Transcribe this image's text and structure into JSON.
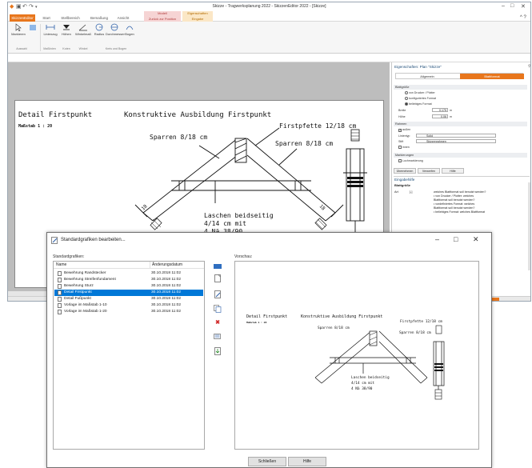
{
  "app": {
    "title": "Skizze - Tragwerksplanung 2022 - SkizzenEditor 2022 - [Skizze]",
    "window_controls": [
      "–",
      "□",
      "✕"
    ],
    "help_glyph": "^ ?",
    "tabs": [
      "SkizzenEditor",
      "Start",
      "Stellbereich",
      "Bemaßung",
      "Ansicht"
    ],
    "active_tab": "SkizzenEditor",
    "context_groups": [
      {
        "header": "Modell",
        "tab": "Zurück zur Position",
        "color": "#f6d4d4"
      },
      {
        "header": "Eigenschaften",
        "tab": "Eingabe",
        "color": "#fbe7c6"
      }
    ],
    "ribbon": {
      "buttons": [
        "Markieren",
        "Linienzug",
        "Höhen",
        "Winkelmaß",
        "Radius",
        "Durchmesser",
        "Bogen"
      ],
      "groups": [
        "Auswahl",
        "Maßlinien",
        "Koten",
        "Winkel",
        "Kreis und Bogen"
      ]
    }
  },
  "drawing": {
    "heading_left": "Detail Firstpunkt",
    "heading_main": "Konstruktive Ausbildung Firstpunkt",
    "scale": "Maßstab 1 : 20",
    "label_firstpfette": "Firstpfette 12/18 cm",
    "label_sparren_left": "Sparren 8/18 cm",
    "label_sparren_right": "Sparren 8/18 cm",
    "label_laschen_1": "Laschen beidseitig",
    "label_laschen_2": "4/14 cm mit",
    "label_laschen_3": "4 Nä 38/90",
    "dim_18": "18"
  },
  "properties": {
    "title": "Eigenschaften: Plan \"Skizze\"",
    "tabs": [
      "Allgemein",
      "Blattformat"
    ],
    "sections": {
      "blattgroesse": "Blattgröße",
      "rahmen": "Rahmen",
      "markierungen": "Markierungen"
    },
    "radios": [
      "von Drucker / Plotter",
      "konfiguriertes Format",
      "beliebiges Format"
    ],
    "fields": [
      {
        "label": "Breite",
        "value": "0.175",
        "unit": "m"
      },
      {
        "label": "Höhe",
        "value": "0.06",
        "unit": "m"
      }
    ],
    "rahmen": {
      "aussen": "außen",
      "linientyp_label": "Linientyp",
      "linientyp_value": "Solid",
      "stift_label": "Stift",
      "stift_value": "Skizzenrahmen",
      "innen": "innen"
    },
    "lochmarkierung": "Lochmarkierung",
    "buttons": [
      "Übernehmen",
      "Verwerfen",
      "Hilfe"
    ],
    "help_title": "Eingabehilfe",
    "help_subtitle": "Blattgröße",
    "help_key": "Art",
    "help_sym": "[-]",
    "help_lines": [
      "welches Blattformat soll benutzt werden?",
      "• von Drucker / Plotter: welches",
      "Blattformat soll benutzt werden?",
      "• vordefiniertes Format: welches",
      "Blattformat soll benutzt werden?",
      "• beliebiges Format: welches Blattformat"
    ]
  },
  "dialog": {
    "title": "Standardgrafiken bearbeiten...",
    "list_label": "Standardgrafiken:",
    "preview_label": "Vorschau:",
    "columns": [
      "Name",
      "Änderungsdatum"
    ],
    "rows": [
      {
        "name": "Bewehrung Randstecker",
        "date": "30.10.2018 11:02",
        "selected": false
      },
      {
        "name": "Bewehrung Streifenfundament",
        "date": "30.10.2018 11:02",
        "selected": false
      },
      {
        "name": "Bewehrung Sturz",
        "date": "30.10.2018 11:02",
        "selected": false
      },
      {
        "name": "Detail Firstpunkt",
        "date": "30.10.2018 11:02",
        "selected": true
      },
      {
        "name": "Detail Fußpunkt",
        "date": "30.10.2018 11:02",
        "selected": false
      },
      {
        "name": "Vorlage im Maßstab 1-10",
        "date": "30.10.2018 11:02",
        "selected": false
      },
      {
        "name": "Vorlage im Maßstab 1-20",
        "date": "30.10.2018 11:02",
        "selected": false
      }
    ],
    "buttons": {
      "close": "Schließen",
      "help": "Hilfe"
    },
    "window_controls": [
      "–",
      "□",
      "✕"
    ],
    "tools": [
      "new-icon",
      "edit-icon",
      "copy-icon",
      "duplicate-icon",
      "delete-icon",
      "export-icon",
      "import-icon"
    ]
  },
  "colors": {
    "accent": "#e8761c",
    "selection": "#0078d7",
    "delete": "#d12b2b"
  }
}
